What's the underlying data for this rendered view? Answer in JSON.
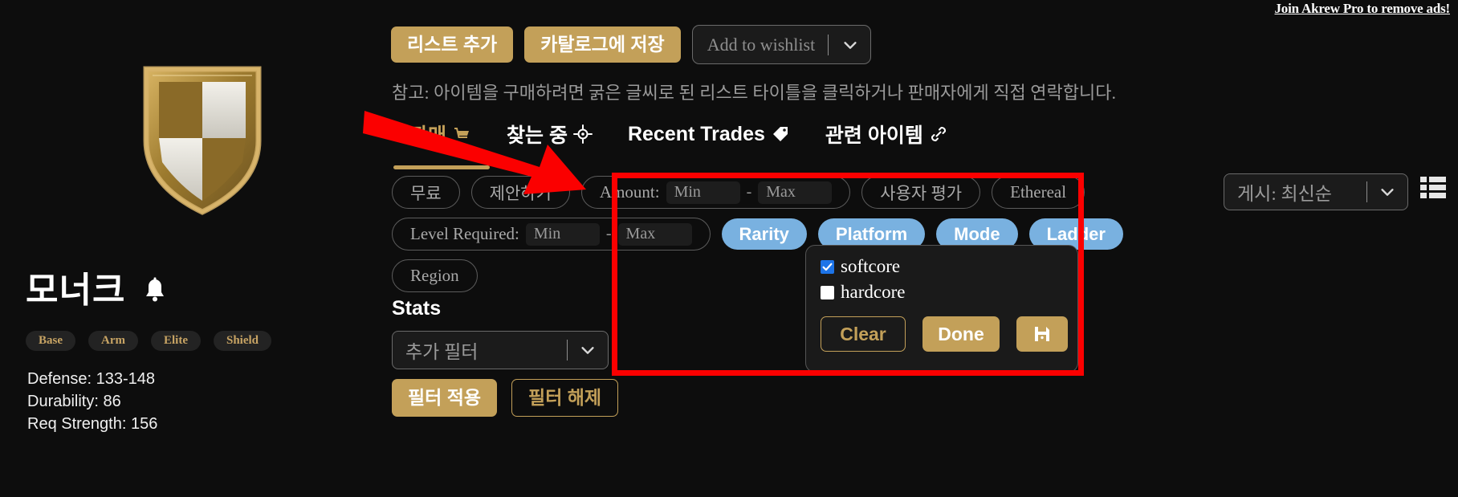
{
  "ad": {
    "text": "Join Akrew Pro to remove ads!"
  },
  "item": {
    "name": "모너크",
    "bell_icon": "bell-icon",
    "tags": [
      "Base",
      "Arm",
      "Elite",
      "Shield"
    ],
    "stats": [
      "Defense: 133-148",
      "Durability: 86",
      "Req Strength: 156"
    ]
  },
  "actions": {
    "add_list": "리스트 추가",
    "save_catalog": "카탈로그에 저장",
    "wishlist_label": "Add to wishlist",
    "wishlist_chevron": "chevron-down-icon"
  },
  "note": "참고: 아이템을 구매하려면 굵은 글씨로 된 리스트 타이틀을 클릭하거나 판매자에게 직접 연락합니다.",
  "tabs": [
    {
      "label": "판매",
      "icon": "cart-icon",
      "active": true
    },
    {
      "label": "찾는 중",
      "icon": "crosshair-icon",
      "active": false
    },
    {
      "label": "Recent Trades",
      "icon": "tag-icon",
      "active": false
    },
    {
      "label": "관련 아이템",
      "icon": "link-icon",
      "active": false
    }
  ],
  "filters": {
    "row1": [
      {
        "type": "pill",
        "label": "무료"
      },
      {
        "type": "pill",
        "label": "제안하기"
      },
      {
        "type": "range",
        "label": "Amount:",
        "min_placeholder": "Min",
        "max_placeholder": "Max",
        "dash": "-"
      },
      {
        "type": "pill",
        "label": "사용자 평가"
      },
      {
        "type": "pill",
        "label": "Ethereal"
      }
    ],
    "row2_range": {
      "label": "Level Required:",
      "min_placeholder": "Min",
      "max_placeholder": "Max",
      "dash": "-"
    },
    "row2_blue": [
      "Rarity",
      "Platform",
      "Mode",
      "Ladder"
    ],
    "row3": [
      {
        "type": "pill",
        "label": "Region"
      }
    ]
  },
  "stats_section": {
    "heading": "Stats",
    "select_value": "추가 필터",
    "select_chevron": "chevron-down-icon",
    "apply_label": "필터 적용",
    "reset_label": "필터 해제"
  },
  "sort": {
    "value": "게시: 최신순",
    "chevron": "chevron-down-icon",
    "view_icon": "grid-view-icon"
  },
  "dropdown": {
    "options": [
      {
        "label": "softcore",
        "checked": true
      },
      {
        "label": "hardcore",
        "checked": false
      }
    ],
    "clear_label": "Clear",
    "done_label": "Done",
    "save_icon": "floppy-save-icon"
  },
  "colors": {
    "background": "#0d0d0d",
    "gold": "#c3a059",
    "blue_pill": "#79b1e0",
    "annotation_red": "#fb0000",
    "checkbox_blue": "#1d74e8",
    "tag_text": "#c8a464"
  }
}
